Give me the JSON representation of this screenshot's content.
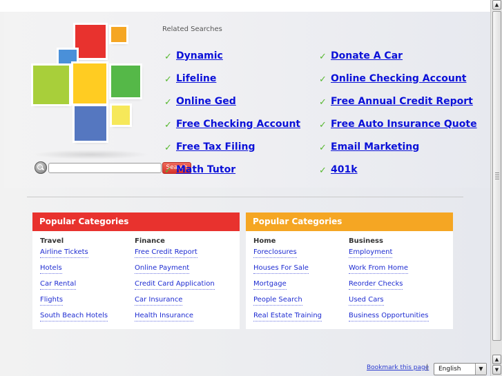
{
  "search": {
    "placeholder": "",
    "button_label": "Search"
  },
  "related": {
    "title": "Related Searches",
    "left": [
      "Dynamic",
      "Lifeline",
      "Online Ged",
      "Free Checking Account",
      "Free Tax Filing",
      "Math Tutor"
    ],
    "right": [
      "Donate A Car",
      "Online Checking Account",
      "Free Annual Credit Report",
      "Free Auto Insurance Quote",
      "Email Marketing",
      "401k"
    ],
    "check_glyph": "✓"
  },
  "panels": [
    {
      "title": "Popular Categories",
      "color": "#e8322e",
      "columns": [
        {
          "heading": "Travel",
          "links": [
            "Airline Tickets",
            "Hotels",
            "Car Rental",
            "Flights",
            "South Beach Hotels"
          ]
        },
        {
          "heading": "Finance",
          "links": [
            "Free Credit Report",
            "Online Payment",
            "Credit Card Application",
            "Car Insurance",
            "Health Insurance"
          ]
        }
      ]
    },
    {
      "title": "Popular Categories",
      "color": "#f5a623",
      "columns": [
        {
          "heading": "Home",
          "links": [
            "Foreclosures",
            "Houses For Sale",
            "Mortgage",
            "People Search",
            "Real Estate Training"
          ]
        },
        {
          "heading": "Business",
          "links": [
            "Employment",
            "Work From Home",
            "Reorder Checks",
            "Used Cars",
            "Business Opportunities"
          ]
        }
      ]
    }
  ],
  "footer": {
    "bookmark_label": "Bookmark this page",
    "separator": "|",
    "language_selected": "English"
  },
  "logo_colors": {
    "red": "#e8322e",
    "orange": "#f5a623",
    "blue_small": "#4a90d9",
    "lime": "#a8cf3a",
    "yellow": "#ffcc22",
    "green": "#55b848",
    "blue": "#5577c0",
    "yellow_small": "#f6e85a"
  },
  "icons": {
    "search": "search-icon",
    "scroll_up": "▲",
    "scroll_down": "▼",
    "select_arrow": "▼"
  }
}
